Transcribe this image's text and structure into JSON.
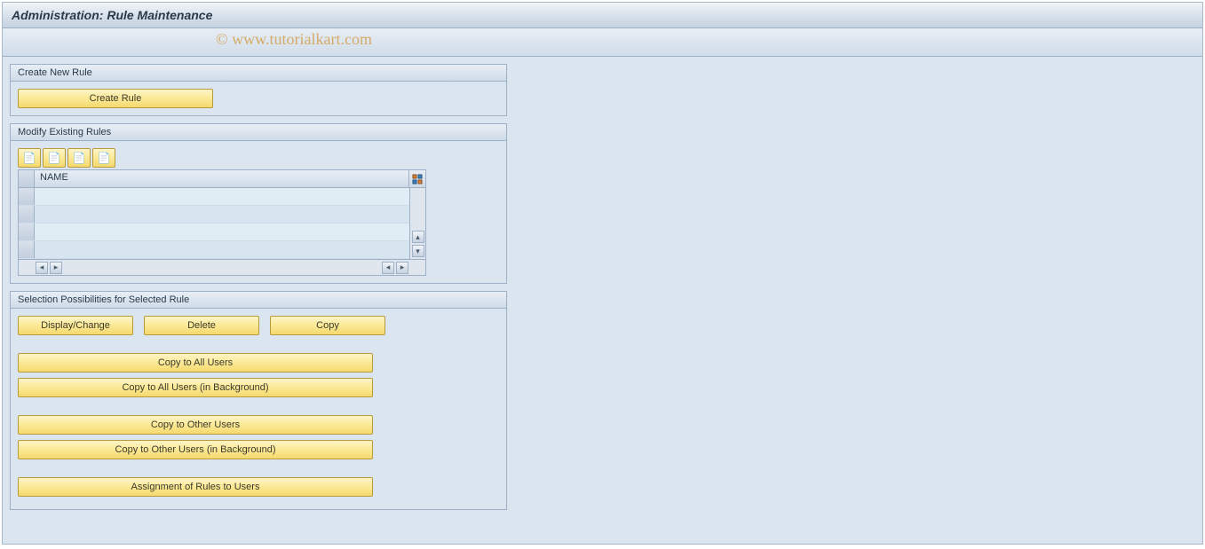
{
  "page_title": "Administration: Rule Maintenance",
  "watermark": "© www.tutorialkart.com",
  "create_box": {
    "title": "Create New Rule",
    "create_button": "Create Rule"
  },
  "modify_box": {
    "title": "Modify Existing Rules",
    "column_header": "NAME",
    "rows": [
      "",
      "",
      "",
      ""
    ]
  },
  "selection_box": {
    "title": "Selection Possibilities for Selected Rule",
    "display_change": "Display/Change",
    "delete": "Delete",
    "copy": "Copy",
    "copy_all": "Copy to All Users",
    "copy_all_bg": "Copy to All Users (in Background)",
    "copy_other": "Copy to Other Users",
    "copy_other_bg": "Copy to Other Users (in Background)",
    "assign": "Assignment of Rules to Users"
  }
}
